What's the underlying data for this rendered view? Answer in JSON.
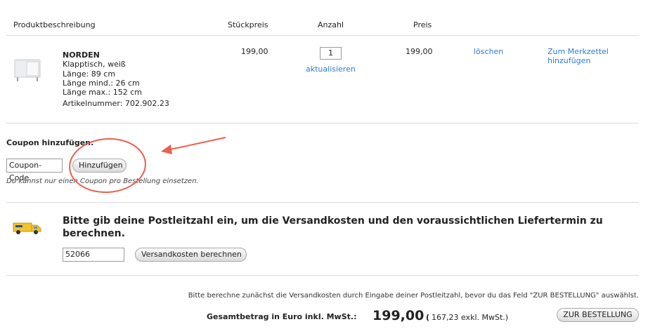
{
  "table_header": {
    "description": "Produktbeschreibung",
    "unit_price": "Stückpreis",
    "quantity": "Anzahl",
    "price": "Preis"
  },
  "product": {
    "name": "NORDEN",
    "subtitle": "Klapptisch, weiß",
    "length": "Länge: 89 cm",
    "length_min": "Länge mind.: 26 cm",
    "length_max": "Länge max.: 152 cm",
    "article_number": "Artikelnummer: 702.902.23",
    "unit_price": "199,00",
    "quantity": "1",
    "update_label": "aktualisieren",
    "price": "199,00",
    "delete_label": "löschen",
    "wishlist_label": "Zum Merkzettel hinzufügen"
  },
  "coupon": {
    "heading": "Coupon hinzufügen:",
    "input_value": "Coupon-Code",
    "add_button": "Hinzufügen",
    "note": "Du kannst nur einen Coupon pro Bestellung einsetzen."
  },
  "shipping": {
    "heading": "Bitte gib deine Postleitzahl ein, um die Versandkosten und den voraussichtlichen Liefertermin zu berechnen.",
    "postal_code": "52066",
    "calc_button": "Versandkosten berechnen"
  },
  "checkout": {
    "notice": "Bitte berechne zunächst die Versandkosten durch Eingabe deiner Postleitzahl, bevor du das Feld \"ZUR BESTELLUNG\" auswählst.",
    "total_label": "Gesamtbetrag in Euro inkl. MwSt.:",
    "total_value": "199,00",
    "excl_open": "(",
    "excl_text": "167,23 exkl. MwSt.)",
    "order_button": "ZUR BESTELLUNG"
  },
  "colors": {
    "link": "#2f7bd1",
    "annotation": "#e8604f",
    "truck": "#f2c230"
  }
}
